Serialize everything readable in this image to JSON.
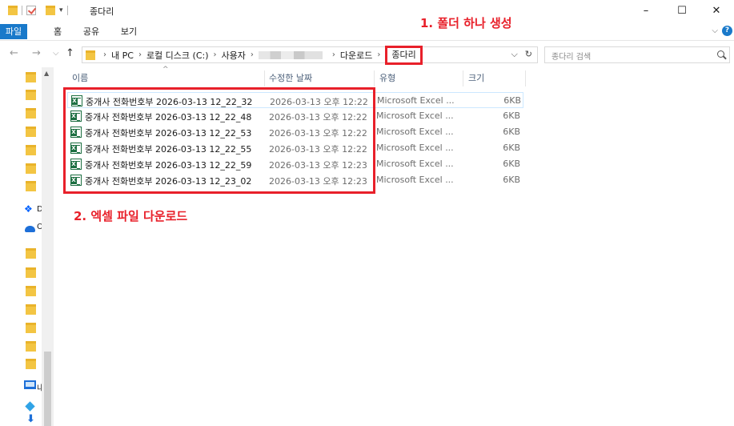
{
  "window": {
    "title": "종다리",
    "minimize": "–",
    "maximize": "☐",
    "close": "✕"
  },
  "ribbon": {
    "tabs": [
      "파일",
      "홈",
      "공유",
      "보기"
    ],
    "expand": "⌵",
    "help": "?"
  },
  "annotations": {
    "step1": "1. 폴더 하나 생성",
    "step2": "2. 엑셀 파일 다운로드"
  },
  "address": {
    "back": "←",
    "forward": "→",
    "recent": "⌵",
    "up": "↑",
    "crumbs": [
      "내 PC",
      "로컬 디스크 (C:)",
      "사용자",
      "다운로드",
      "종다리"
    ],
    "separator": "›",
    "dropdown": "⌵",
    "refresh": "↻"
  },
  "search": {
    "placeholder": "종다리 검색"
  },
  "nav": {
    "dropbox_label": "D",
    "onedrive_label": "O",
    "pc_label": "내",
    "scroll_up": "▲"
  },
  "columns": {
    "name": "이름",
    "modified": "수정한 날짜",
    "type": "유형",
    "size": "크기",
    "sort_indicator": "^"
  },
  "files": [
    {
      "name": "중개사 전화번호부 2026-03-13 12_22_32",
      "modified": "2026-03-13 오후 12:22",
      "type": "Microsoft Excel ...",
      "size": "6KB"
    },
    {
      "name": "중개사 전화번호부 2026-03-13 12_22_48",
      "modified": "2026-03-13 오후 12:22",
      "type": "Microsoft Excel ...",
      "size": "6KB"
    },
    {
      "name": "중개사 전화번호부 2026-03-13 12_22_53",
      "modified": "2026-03-13 오후 12:22",
      "type": "Microsoft Excel ...",
      "size": "6KB"
    },
    {
      "name": "중개사 전화번호부 2026-03-13 12_22_55",
      "modified": "2026-03-13 오후 12:22",
      "type": "Microsoft Excel ...",
      "size": "6KB"
    },
    {
      "name": "중개사 전화번호부 2026-03-13 12_22_59",
      "modified": "2026-03-13 오후 12:23",
      "type": "Microsoft Excel ...",
      "size": "6KB"
    },
    {
      "name": "중개사 전화번호부 2026-03-13 12_23_02",
      "modified": "2026-03-13 오후 12:23",
      "type": "Microsoft Excel ...",
      "size": "6KB"
    }
  ],
  "colors": {
    "annotation": "#e8202a",
    "file_tab": "#1979ca",
    "folder": "#f3c543"
  }
}
